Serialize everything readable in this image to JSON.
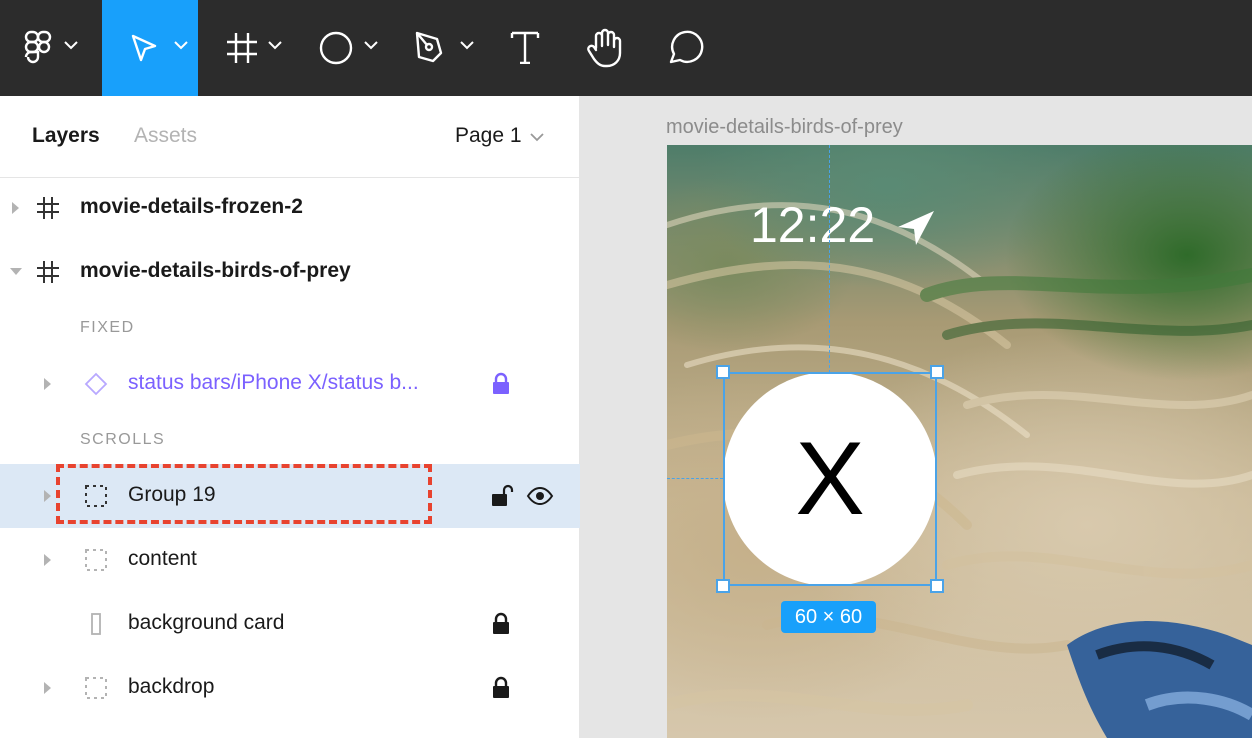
{
  "toolbar": {
    "tools": [
      {
        "name": "main-menu",
        "icon": "figma-logo-icon",
        "active": false
      },
      {
        "name": "move",
        "icon": "move-cursor-icon",
        "active": true
      },
      {
        "name": "frame",
        "icon": "frame-hash-icon",
        "active": false
      },
      {
        "name": "ellipse",
        "icon": "ellipse-icon",
        "active": false
      },
      {
        "name": "pen",
        "icon": "pen-icon",
        "active": false
      },
      {
        "name": "text",
        "icon": "text-icon",
        "active": false
      },
      {
        "name": "hand",
        "icon": "hand-icon",
        "active": false
      },
      {
        "name": "comment",
        "icon": "comment-icon",
        "active": false
      }
    ],
    "active_color": "#18a0fb",
    "background": "#2c2c2c"
  },
  "panel": {
    "tabs": {
      "layers": "Layers",
      "assets": "Assets"
    },
    "page": "Page 1",
    "layers": [
      {
        "label": "movie-details-frozen-2",
        "type": "frame",
        "expanded": false
      },
      {
        "label": "movie-details-birds-of-prey",
        "type": "frame",
        "expanded": true
      },
      {
        "label": "status bars/iPhone X/status b...",
        "type": "component",
        "locked": true
      },
      {
        "label": "Group 19",
        "type": "group",
        "selected": true,
        "locked": false,
        "visible": true
      },
      {
        "label": "content",
        "type": "group"
      },
      {
        "label": "background card",
        "type": "rectangle",
        "locked": true
      },
      {
        "label": "backdrop",
        "type": "group",
        "locked": true
      }
    ],
    "sections": {
      "fixed": "FIXED",
      "scrolls": "SCROLLS"
    },
    "selected_row_color": "#dce8f5",
    "component_color": "#7b61ff",
    "highlight_color": "#e8432f"
  },
  "canvas": {
    "frame_title": "movie-details-birds-of-prey",
    "status_time": "12:22",
    "button_label": "X",
    "size_badge": "60 × 60",
    "selection_color": "#4aa3e8"
  }
}
